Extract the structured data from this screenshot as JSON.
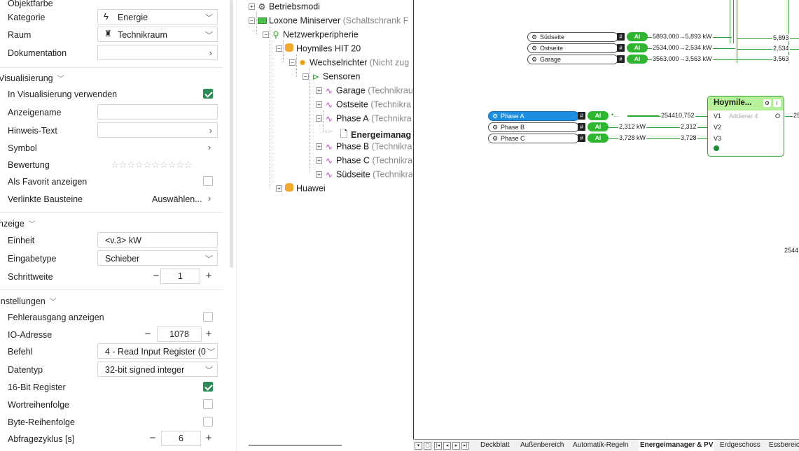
{
  "properties": {
    "color_row": {
      "label": "Objektfarbe",
      "colors": [
        "#e8415a",
        "#f07f3a",
        "#f2c12e",
        "#52c45c",
        "#31b4e0",
        "#6c5ce7",
        "#d04ad6"
      ]
    },
    "category": {
      "label": "Kategorie",
      "value": "Energie",
      "icon": "lightning-icon"
    },
    "room": {
      "label": "Raum",
      "value": "Technikraum",
      "icon": "tower-icon"
    },
    "documentation": {
      "label": "Dokumentation"
    },
    "visualization_section": "Visualisierung",
    "use_in_visualization": {
      "label": "In Visualisierung verwenden",
      "checked": true
    },
    "display_name": {
      "label": "Anzeigename",
      "value": ""
    },
    "hint_text": {
      "label": "Hinweis-Text"
    },
    "symbol": {
      "label": "Symbol"
    },
    "rating": {
      "label": "Bewertung",
      "stars": "☆☆☆☆☆☆☆☆☆☆"
    },
    "favorite": {
      "label": "Als Favorit anzeigen",
      "checked": false
    },
    "linked_blocks": {
      "label": "Verlinkte Bausteine",
      "value": "Auswählen..."
    },
    "display_section": "nzeige",
    "unit": {
      "label": "Einheit",
      "value": "<v.3> kW"
    },
    "input_type": {
      "label": "Eingabetype",
      "value": "Schieber"
    },
    "step": {
      "label": "Schrittweite",
      "value": "1"
    },
    "settings_section": "instellungen",
    "show_error_output": {
      "label": "Fehlerausgang anzeigen",
      "checked": false
    },
    "io_address": {
      "label": "IO-Adresse",
      "value": "1078"
    },
    "command": {
      "label": "Befehl",
      "value": "4 - Read Input Register (0"
    },
    "datatype": {
      "label": "Datentyp",
      "value": "32-bit signed integer"
    },
    "register16": {
      "label": "16-Bit Register",
      "checked": true
    },
    "word_order": {
      "label": "Wortreihenfolge",
      "checked": false
    },
    "byte_order": {
      "label": "Byte-Reihenfolge",
      "checked": false
    },
    "poll_cycle": {
      "label": "Abfragezyklus [s]",
      "value": "6"
    },
    "section_icon": "chevron-down-icon"
  },
  "tree": {
    "n0": {
      "label": "Betriebsmodi",
      "icon": "gear-icon"
    },
    "n1": {
      "label": "Loxone Miniserver",
      "sub": "(Schaltschrank F",
      "icon": "server-icon"
    },
    "n2": {
      "label": "Netzwerkperipherie",
      "icon": "network-icon"
    },
    "n3": {
      "label": "Hoymiles HIT 20",
      "icon": "database-icon"
    },
    "n4": {
      "label": "Wechselrichter",
      "sub": "(Nicht zug",
      "icon": "sun-icon"
    },
    "n5": {
      "label": "Sensoren",
      "icon": "sensor-folder-icon"
    },
    "n6": {
      "label": "Garage",
      "sub": "(Technikrau",
      "icon": "sensor-icon"
    },
    "n7": {
      "label": "Ostseite",
      "sub": "(Technikra",
      "icon": "sensor-icon"
    },
    "n8": {
      "label": "Phase A",
      "sub": "(Technikra",
      "icon": "sensor-icon"
    },
    "n9": {
      "label": "Energeimanag",
      "icon": "document-icon"
    },
    "n10": {
      "label": "Phase B",
      "sub": "(Technikra",
      "icon": "sensor-icon"
    },
    "n11": {
      "label": "Phase C",
      "sub": "(Technikra",
      "icon": "sensor-icon"
    },
    "n12": {
      "label": "Südseite",
      "sub": "(Technikra",
      "icon": "sensor-icon"
    },
    "n13": {
      "label": "Huawei",
      "icon": "database-icon"
    }
  },
  "canvas": {
    "inputs_top": [
      {
        "name": "Südseite",
        "ai": "AI",
        "value": "5893,000→5,893 kW",
        "out": "5,893"
      },
      {
        "name": "Ostseite",
        "ai": "AI",
        "value": "2534,000→2,534 kW",
        "out": "2,534"
      },
      {
        "name": "Garage",
        "ai": "AI",
        "value": "3563,000→3,563 kW",
        "out": "3,563"
      }
    ],
    "inputs_phase": [
      {
        "name": "Phase A",
        "ai": "AI",
        "value": "254410,752",
        "port": "V1",
        "selected": true
      },
      {
        "name": "Phase B",
        "ai": "AI",
        "value": "2,312 kW",
        "out": "2,312",
        "port": "V2",
        "selected": false
      },
      {
        "name": "Phase C",
        "ai": "AI",
        "value": "3,728 kW",
        "out": "3,728",
        "port": "V3",
        "selected": false
      }
    ],
    "phase_a_dots": "•...",
    "adder": {
      "title": "Hoymile...",
      "subtitle": "Addierer 4",
      "output_port": "O",
      "output_value": "25"
    },
    "stray_value": "2544"
  },
  "tabs": {
    "nav": [
      "▾",
      "▢",
      "|◂",
      "◂",
      "▸",
      "▸|"
    ],
    "items": [
      "Deckblatt",
      "Außenbereich",
      "Automatik-Regeln",
      "Energeimanager & PV",
      "Erdgeschoss",
      "Essbereic"
    ],
    "active_index": 3
  }
}
